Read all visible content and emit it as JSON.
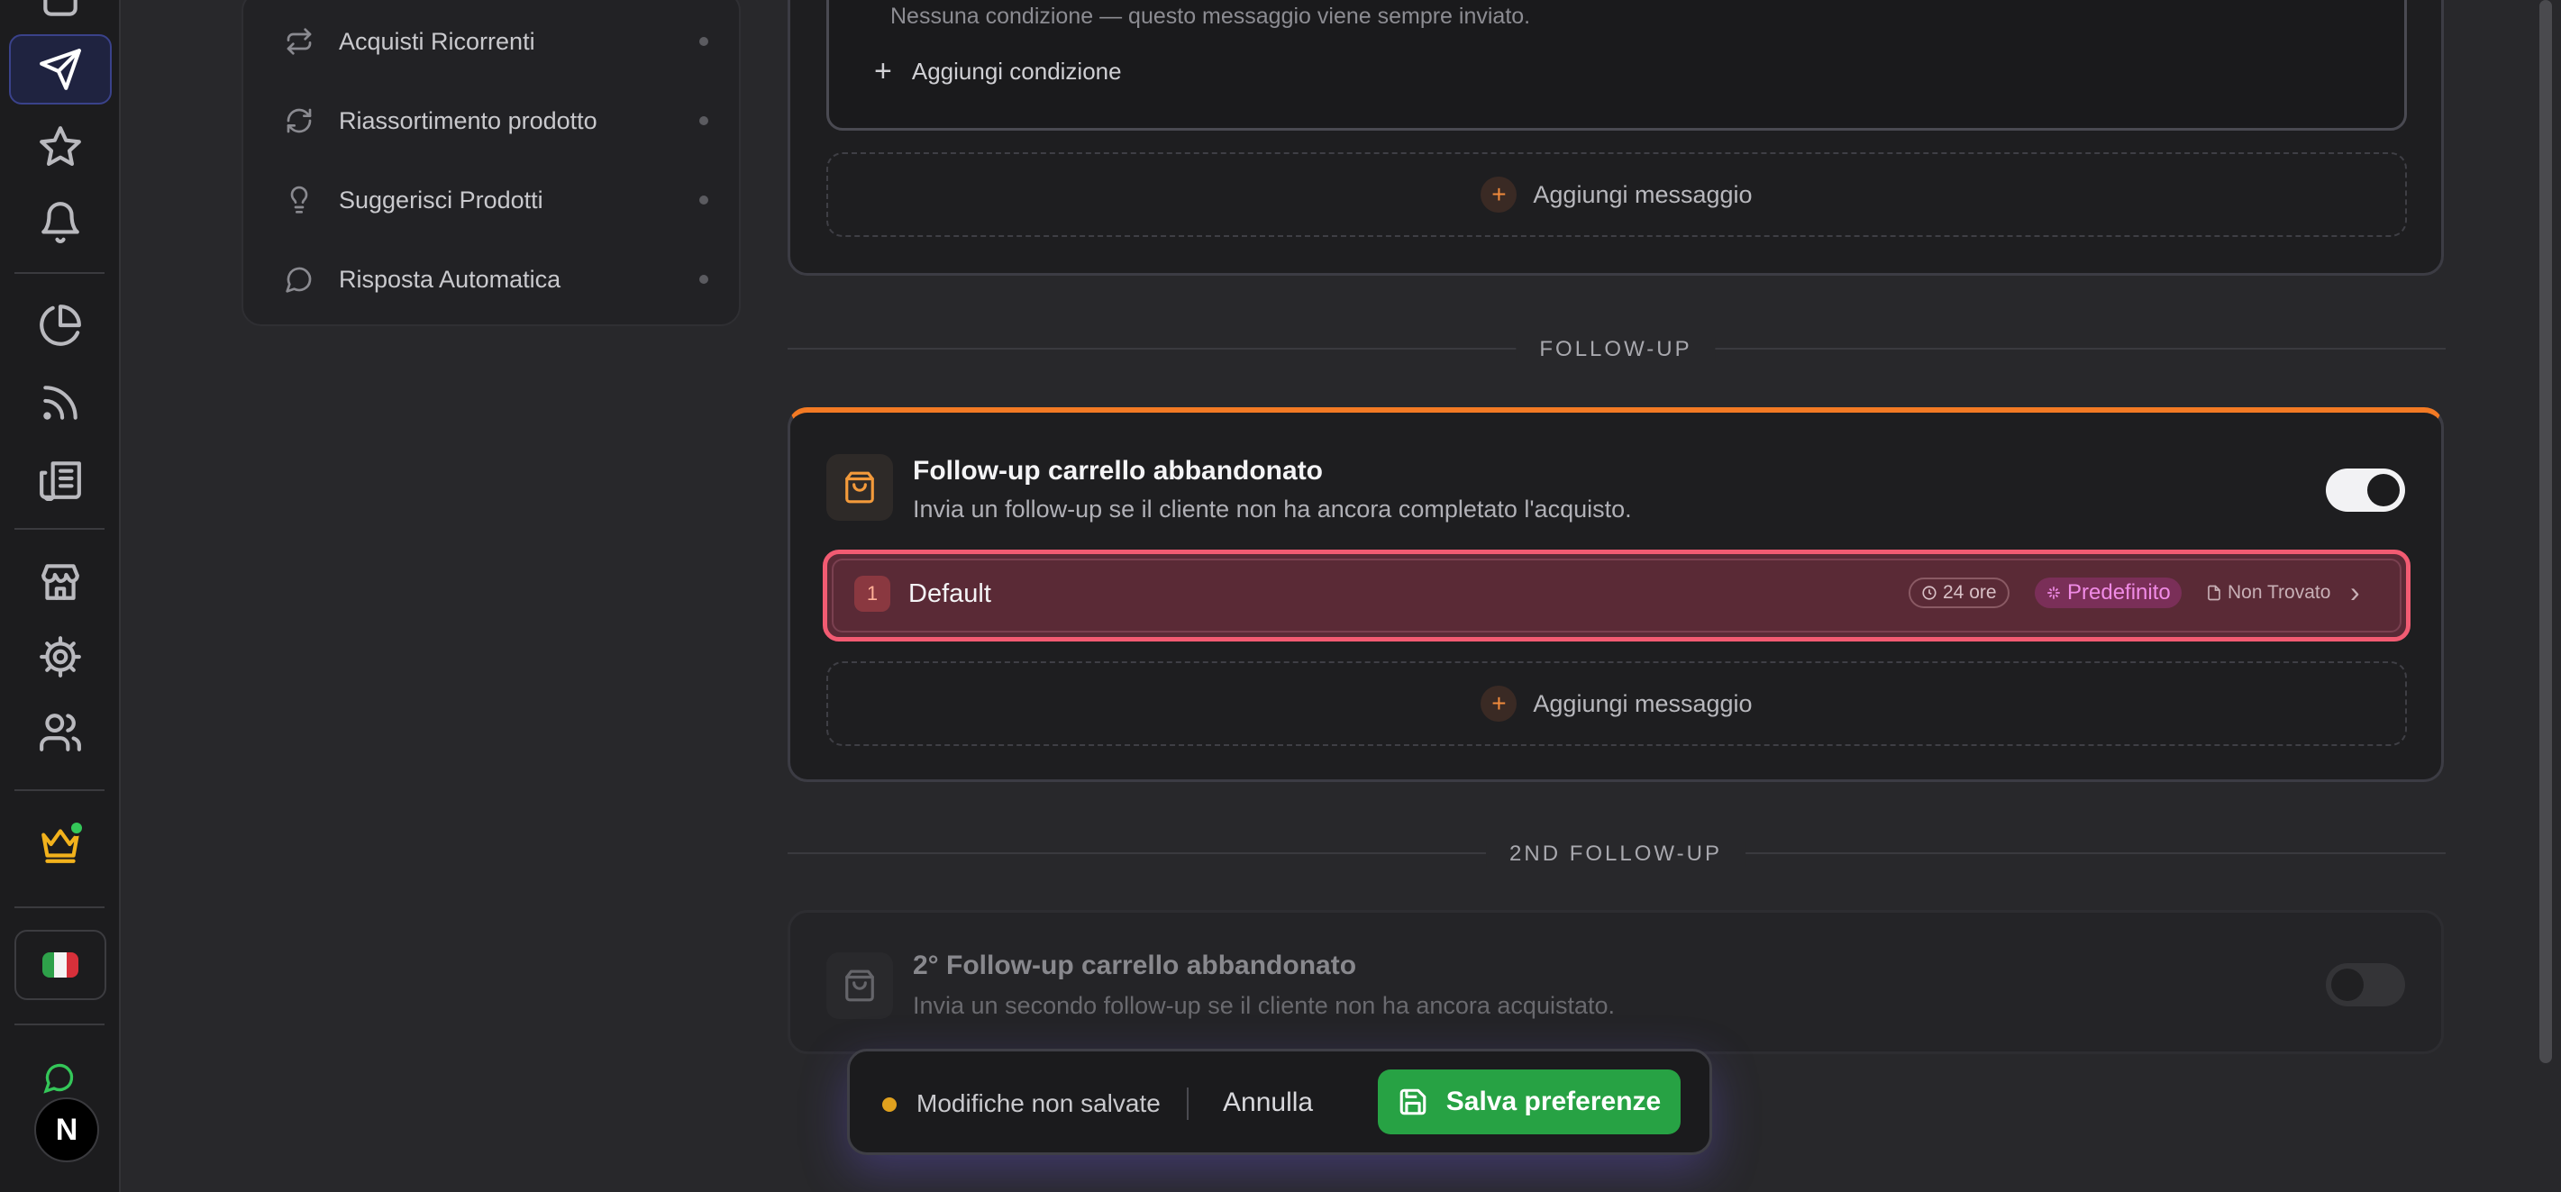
{
  "subnav": {
    "items": [
      {
        "label": "Acquisti Ricorrenti",
        "icon": "repeat-icon"
      },
      {
        "label": "Riassortimento prodotto",
        "icon": "refresh-icon"
      },
      {
        "label": "Suggerisci Prodotti",
        "icon": "lightbulb-icon"
      },
      {
        "label": "Risposta Automatica",
        "icon": "message-circle-icon"
      }
    ]
  },
  "top_message": {
    "condition_note": "Nessuna condizione — questo messaggio viene sempre inviato.",
    "add_condition": "Aggiungi condizione",
    "add_message": "Aggiungi messaggio"
  },
  "divider_followup": "FOLLOW-UP",
  "followup": {
    "title": "Follow-up carrello abbandonato",
    "subtitle": "Invia un follow-up se il cliente non ha ancora completato l'acquisto.",
    "enabled": true,
    "message": {
      "index": "1",
      "name": "Default",
      "delay": "24 ore",
      "badge": "Predefinito",
      "template": "Non Trovato"
    },
    "add_message": "Aggiungi messaggio"
  },
  "divider_second": "2ND FOLLOW-UP",
  "second_followup": {
    "title": "2° Follow-up carrello abbandonato",
    "subtitle": "Invia un secondo follow-up se il cliente non ha ancora acquistato.",
    "enabled": false
  },
  "savebar": {
    "status": "Modifiche non salvate",
    "cancel": "Annulla",
    "save": "Salva preferenze"
  },
  "colors": {
    "accent_orange": "#f39a3b",
    "highlight_red": "#f25b72",
    "save_green": "#27a244",
    "badge_pink": "#e070e0"
  }
}
